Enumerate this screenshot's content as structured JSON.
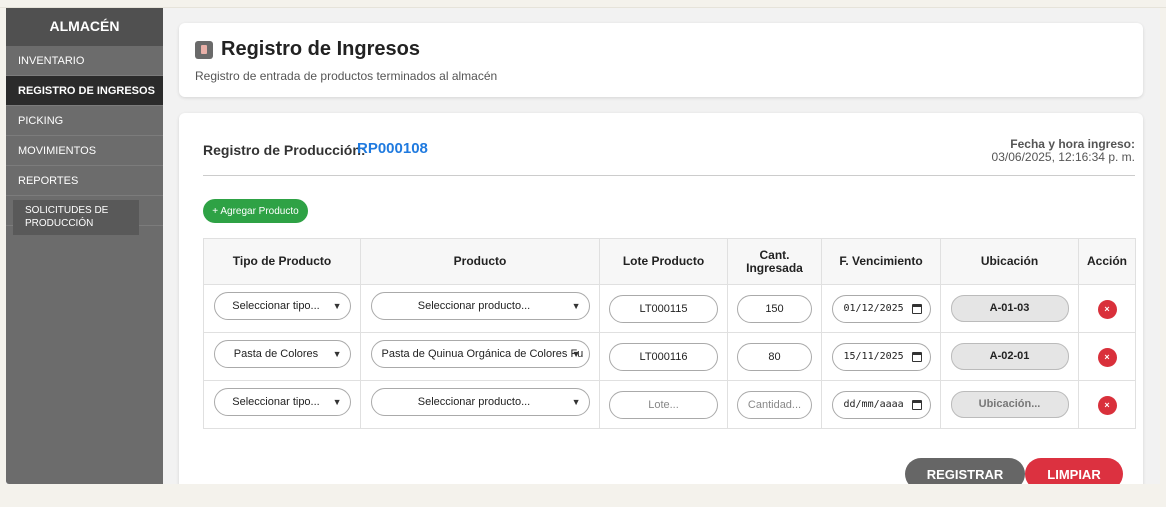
{
  "sidebar": {
    "title": "ALMACÉN",
    "items": [
      {
        "label": "INVENTARIO"
      },
      {
        "label": "REGISTRO DE INGRESOS"
      },
      {
        "label": "PICKING"
      },
      {
        "label": "MOVIMIENTOS"
      },
      {
        "label": "REPORTES"
      }
    ],
    "sub_item": {
      "line1": "SOLICITUDES DE",
      "line2": "PRODUCCIÓN"
    }
  },
  "header": {
    "icon": "clipboard-icon",
    "title": "Registro de Ingresos",
    "subtitle": "Registro de entrada de productos terminados al almacén"
  },
  "form": {
    "registro_label": "Registro de Producción:",
    "registro_value": "RP000108",
    "fecha_label": "Fecha y hora ingreso:",
    "fecha_value": "03/06/2025, 12:16:34 p. m.",
    "add_button": "+ Agregar Producto",
    "columns": {
      "tipo": "Tipo de Producto",
      "producto": "Producto",
      "lote": "Lote Producto",
      "cant_line1": "Cant.",
      "cant_line2": "Ingresada",
      "venc": "F. Vencimiento",
      "ubicacion": "Ubicación",
      "accion": "Acción"
    },
    "rows": [
      {
        "tipo": "Seleccionar tipo...",
        "producto": "Seleccionar producto...",
        "lote": "LT000115",
        "cantidad": "150",
        "vencimiento": "01/12/2025",
        "ubicacion": "A-01-03",
        "delete": "×"
      },
      {
        "tipo": "Pasta de Colores",
        "producto": "Pasta de Quinua Orgánica de Colores Fu",
        "lote": "LT000116",
        "cantidad": "80",
        "vencimiento": "15/11/2025",
        "ubicacion": "A-02-01",
        "delete": "×"
      },
      {
        "tipo": "Seleccionar tipo...",
        "producto": "Seleccionar producto...",
        "lote_placeholder": "Lote...",
        "cantidad_placeholder": "Cantidad...",
        "vencimiento_placeholder": "dd/mm/aaaa",
        "ubicacion_placeholder": "Ubicación...",
        "delete": "×"
      }
    ],
    "register_button": "REGISTRAR",
    "clear_button": "LIMPIAR"
  },
  "colors": {
    "sidebar_bg": "#6c6c6c",
    "sidebar_active": "#2b2b2b",
    "accent_blue": "#1f7adf",
    "add_green": "#2ea245",
    "danger_red": "#dc3140",
    "register_gray": "#666666"
  }
}
